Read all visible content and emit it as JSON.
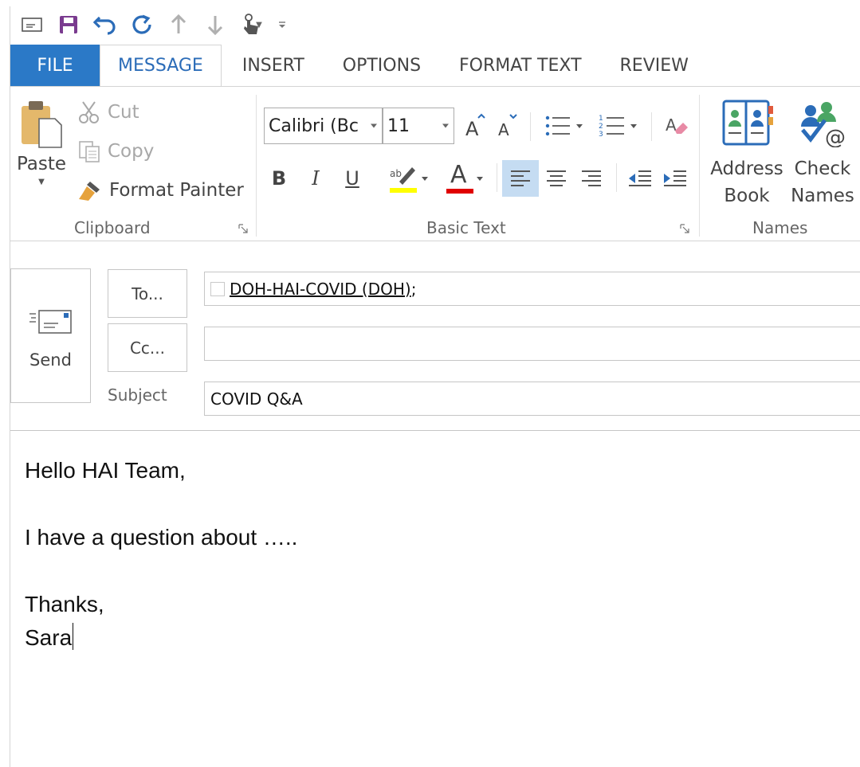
{
  "tabs": [
    {
      "label": "FILE"
    },
    {
      "label": "MESSAGE"
    },
    {
      "label": "INSERT"
    },
    {
      "label": "OPTIONS"
    },
    {
      "label": "FORMAT TEXT"
    },
    {
      "label": "REVIEW"
    }
  ],
  "quick_access": [
    "mail-icon",
    "save-icon",
    "undo-icon",
    "redo-icon",
    "up-arrow-icon",
    "down-arrow-icon",
    "touch-mode-icon",
    "customize-icon"
  ],
  "clipboard": {
    "paste": "Paste",
    "cut": "Cut",
    "copy": "Copy",
    "format_painter": "Format Painter",
    "label": "Clipboard"
  },
  "basic_text": {
    "font_name": "Calibri (Bc",
    "font_size": "11",
    "bold": "B",
    "italic": "I",
    "underline": "U",
    "font_color_letter": "A",
    "label": "Basic Text"
  },
  "names": {
    "address_book_line1": "Address",
    "address_book_line2": "Book",
    "check_names_line1": "Check",
    "check_names_line2": "Names",
    "label": "Names"
  },
  "colors": {
    "file_tab": "#2b79c7",
    "highlight": "#ffff00",
    "font_color": "#e00000",
    "selected_align": "#c5dcf2"
  },
  "header": {
    "send": "Send",
    "to_button": "To...",
    "cc_button": "Cc...",
    "subject_label": "Subject",
    "to_value": "DOH-HAI-COVID (DOH)",
    "to_separator": ";",
    "cc_value": "",
    "subject_value": "COVID Q&A"
  },
  "body": {
    "lines": [
      "Hello HAI Team,",
      "",
      "I have a question about …..",
      "",
      "Thanks,",
      "Sara"
    ]
  }
}
